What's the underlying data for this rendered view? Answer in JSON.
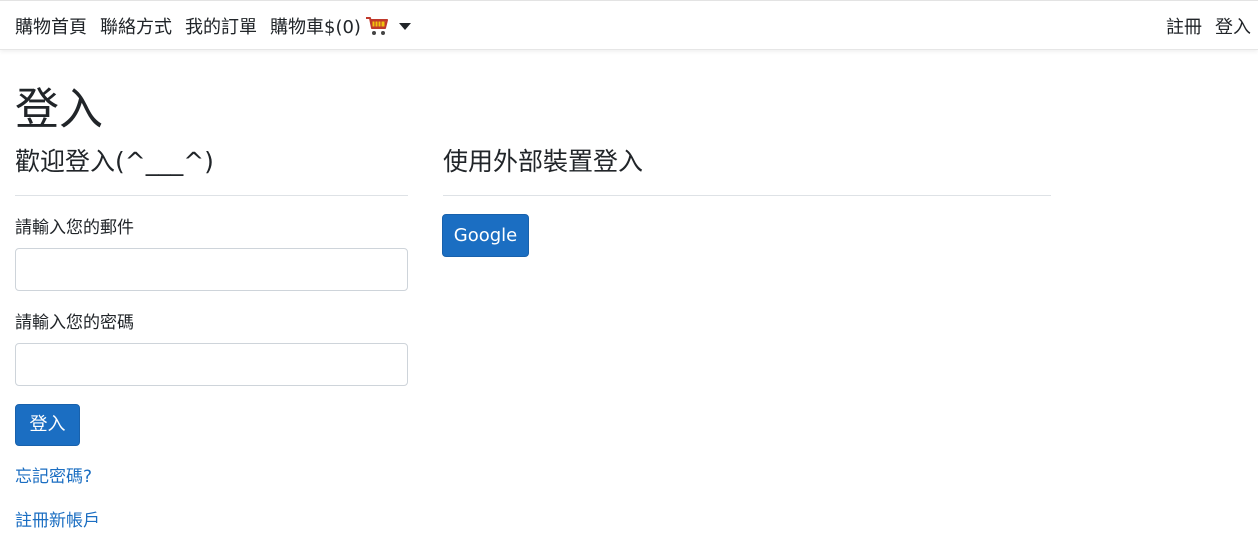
{
  "navbar": {
    "home": "購物首頁",
    "contact": "聯絡方式",
    "orders": "我的訂單",
    "cart_label": "購物車$(0)",
    "register": "註冊",
    "login": "登入"
  },
  "page": {
    "title": "登入"
  },
  "local_login": {
    "heading": "歡迎登入(^___^)",
    "email_label": "請輸入您的郵件",
    "email_value": "",
    "password_label": "請輸入您的密碼",
    "password_value": "",
    "submit_label": "登入",
    "forgot_link": "忘記密碼?",
    "register_link": "註冊新帳戶"
  },
  "external_login": {
    "heading": "使用外部裝置登入",
    "google_label": "Google"
  },
  "colors": {
    "primary": "#1b6ec2",
    "link": "#1b6ec2",
    "text": "#212529"
  },
  "icons": {
    "cart": "shopping-cart-icon",
    "caret": "caret-down-icon"
  }
}
